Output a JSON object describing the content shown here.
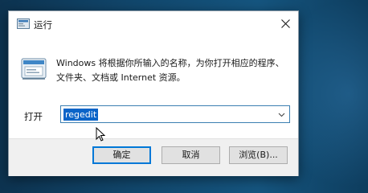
{
  "window": {
    "title": "运行",
    "close_icon": "close-icon",
    "app_icon": "run-app-icon"
  },
  "body": {
    "description": "Windows 将根据你所输入的名称，为你打开相应的程序、文件夹、文档或 Internet 资源。",
    "icon": "run-illustration-icon",
    "open_label": "打开",
    "input_value": "regedit"
  },
  "buttons": {
    "ok": "确定",
    "cancel": "取消",
    "browse": "浏览(B)..."
  },
  "colors": {
    "accent": "#0078d7",
    "selection": "#0a64c8",
    "desktop": "#11466b"
  }
}
